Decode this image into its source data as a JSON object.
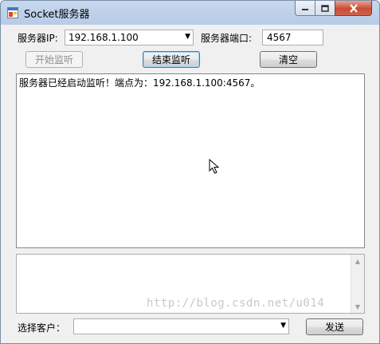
{
  "window": {
    "title": "Socket服务器"
  },
  "server": {
    "ip_label": "服务器IP:",
    "ip_value": "192.168.1.100",
    "port_label": "服务器端口:",
    "port_value": "4567"
  },
  "buttons": {
    "start_label": "开始监听",
    "stop_label": "结束监听",
    "clear_label": "清空",
    "send_label": "发送"
  },
  "log": {
    "text": "服务器已经启动监听！端点为：192.168.1.100:4567。"
  },
  "client": {
    "label": "选择客户：",
    "selected": ""
  },
  "watermark": {
    "text": "http://blog.csdn.net/u014"
  },
  "icons": [
    "app-window-icon",
    "minimize-icon",
    "maximize-icon",
    "close-icon",
    "chevron-down-icon",
    "scroll-up-icon",
    "scroll-down-icon",
    "mouse-cursor-icon"
  ],
  "colors": {
    "titlebar": "#b7cbe6",
    "close_button": "#c74c35",
    "client_bg": "#f0f0f0"
  }
}
